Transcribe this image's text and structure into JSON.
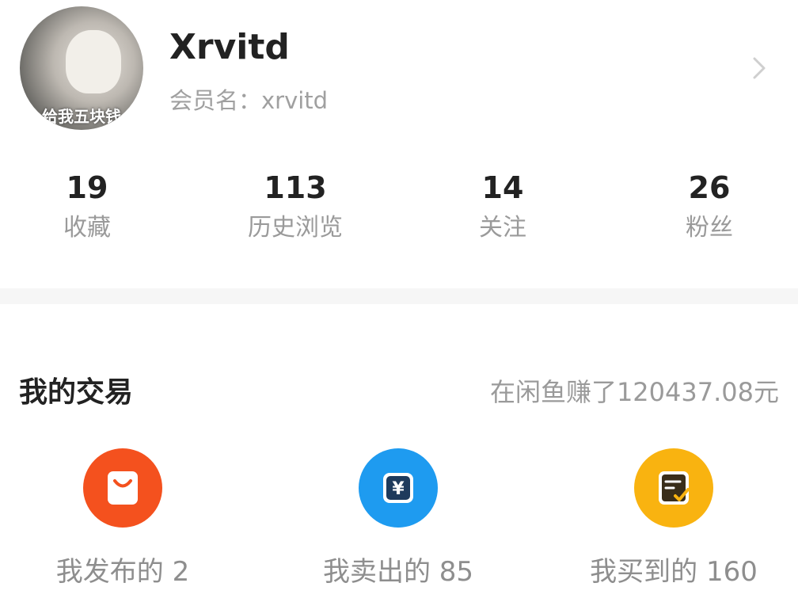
{
  "profile": {
    "avatar_caption": "给我五块钱",
    "nickname": "Xrvitd",
    "member_name": "会员名：xrvitd"
  },
  "stats": [
    {
      "count": "19",
      "label": "收藏"
    },
    {
      "count": "113",
      "label": "历史浏览"
    },
    {
      "count": "14",
      "label": "关注"
    },
    {
      "count": "26",
      "label": "粉丝"
    }
  ],
  "trade": {
    "title": "我的交易",
    "earned": "在闲鱼赚了120437.08元",
    "items": [
      {
        "label": "我发布的 2",
        "icon": "shopping-bag-icon",
        "color": "#f4511e"
      },
      {
        "label": "我卖出的 85",
        "icon": "yen-icon",
        "color": "#1e9bf0"
      },
      {
        "label": "我买到的 160",
        "icon": "receipt-check-icon",
        "color": "#f9b310"
      }
    ]
  }
}
